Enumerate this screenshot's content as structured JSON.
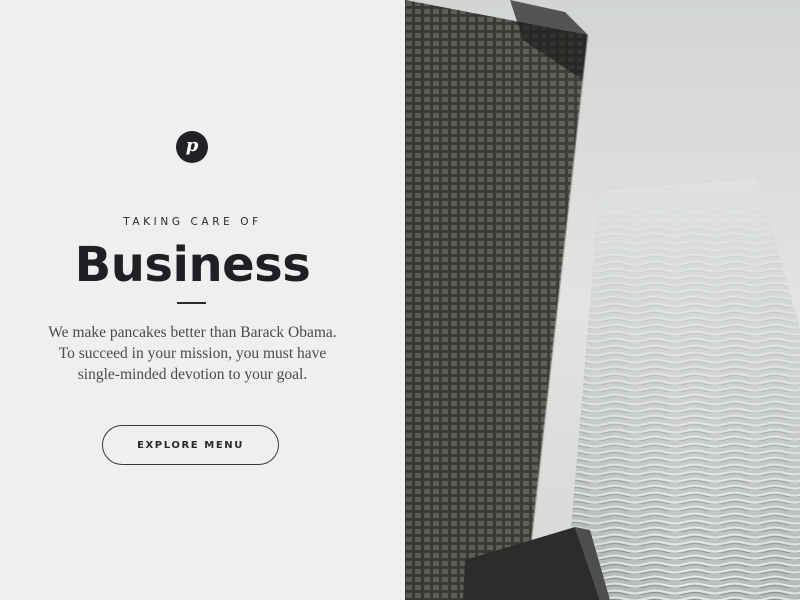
{
  "logo": {
    "letter": "p",
    "icon": "p-monogram-icon"
  },
  "hero": {
    "eyebrow": "TAKING CARE OF",
    "title": "Business",
    "description_lines": [
      "We make pancakes better than Barack Obama.",
      "To succeed in your mission, you must have",
      "single-minded devotion to your goal."
    ],
    "cta_label": "EXPLORE MENU"
  },
  "colors": {
    "background": "#efefef",
    "text_dark": "#1f1f24",
    "text_body": "#4a4a4e"
  }
}
